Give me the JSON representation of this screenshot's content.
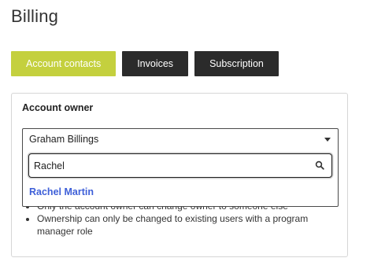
{
  "page": {
    "title": "Billing"
  },
  "tabs": [
    {
      "label": "Account contacts",
      "active": true
    },
    {
      "label": "Invoices",
      "active": false
    },
    {
      "label": "Subscription",
      "active": false
    }
  ],
  "account_owner": {
    "label": "Account owner",
    "selected_value": "Graham Billings",
    "search": {
      "value": "Rachel",
      "icon": "search-icon"
    },
    "options": [
      {
        "label": "Rachel Martin"
      }
    ],
    "rules": [
      "Only the account owner can change owner to someone else",
      "Ownership can only be changed to existing users with a program manager role"
    ]
  },
  "colors": {
    "active_tab": "#c4d03e",
    "inactive_tab": "#2b2b2b",
    "option_link": "#3e5fd8"
  }
}
